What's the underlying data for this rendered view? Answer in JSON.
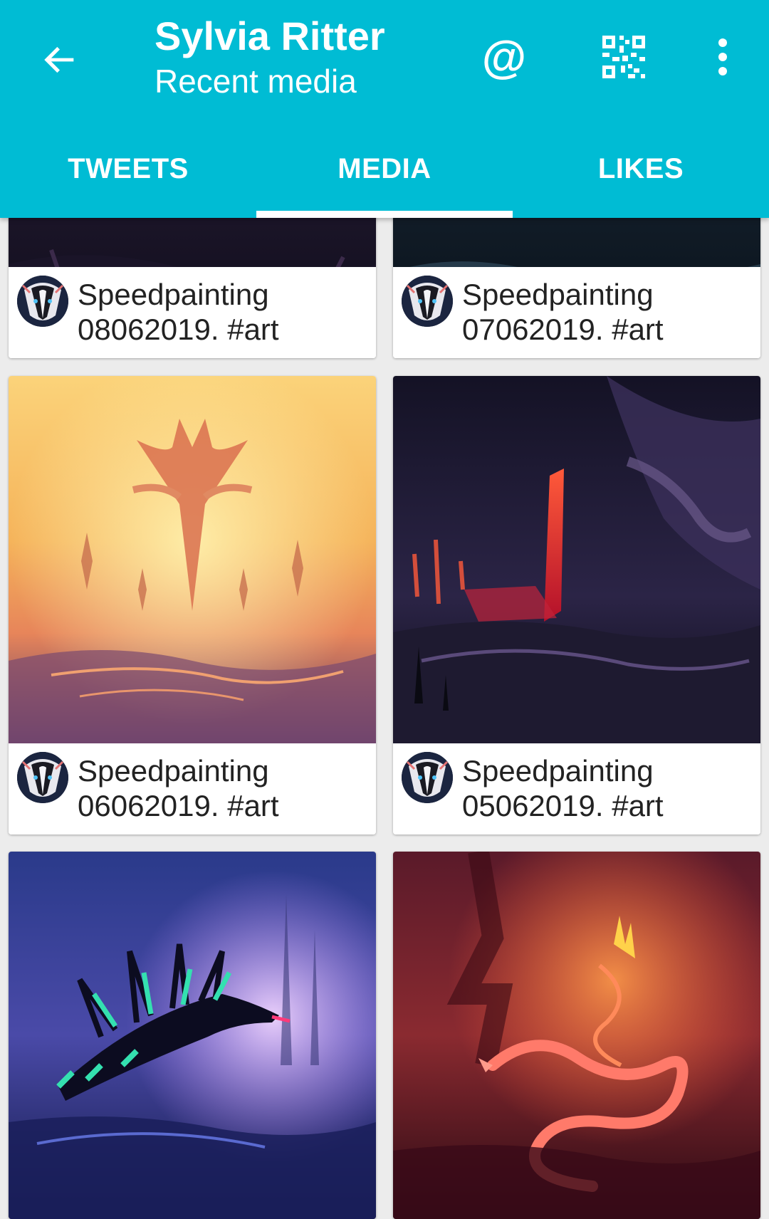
{
  "appbar": {
    "title": "Sylvia Ritter",
    "subtitle": "Recent media",
    "color": "#00bcd4",
    "icons": {
      "back": "arrow-left-icon",
      "mention": "at-sign-icon",
      "qr": "qr-code-icon",
      "more": "more-vertical-icon"
    },
    "mention_glyph": "@"
  },
  "tabs": [
    {
      "label": "TWEETS",
      "active": false
    },
    {
      "label": "MEDIA",
      "active": true
    },
    {
      "label": "LIKES",
      "active": false
    }
  ],
  "media": [
    {
      "caption": "Speedpainting 08062019. #art",
      "palette": "dark-blue"
    },
    {
      "caption": "Speedpainting 07062019. #art",
      "palette": "dark-teal"
    },
    {
      "caption": "Speedpainting 06062019. #art",
      "palette": "golden-sunset"
    },
    {
      "caption": "Speedpainting 05062019. #art",
      "palette": "lava-cave"
    },
    {
      "caption": "",
      "palette": "neon-dragon"
    },
    {
      "caption": "",
      "palette": "fire-serpent"
    }
  ]
}
